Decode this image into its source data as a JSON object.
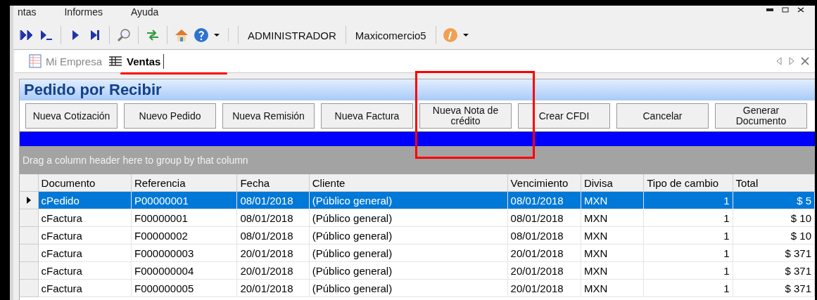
{
  "menu": [
    "ntas",
    "Informes",
    "Ayuda"
  ],
  "toolbar": {
    "user": "ADMINISTRADOR",
    "company": "Maxicomercio5"
  },
  "tabs": [
    {
      "label": "Mi Empresa",
      "selected": false
    },
    {
      "label": "Ventas",
      "selected": true
    }
  ],
  "panel_title": "Pedido por Recibir",
  "buttons": [
    "Nueva Cotización",
    "Nuevo Pedido",
    "Nueva Remisión",
    "Nueva Factura",
    "Nueva Nota de crédito",
    "Crear CFDI",
    "Cancelar",
    "Generar Documento"
  ],
  "group_hint": "Drag a column header here to group by that column",
  "table": {
    "columns": [
      {
        "label": "Documento",
        "kind": "text"
      },
      {
        "label": "Referencia",
        "kind": "text"
      },
      {
        "label": "Fecha",
        "kind": "text"
      },
      {
        "label": "Cliente",
        "kind": "text"
      },
      {
        "label": "Vencimiento",
        "kind": "text"
      },
      {
        "label": "Divisa",
        "kind": "text"
      },
      {
        "label": "Tipo de cambio",
        "kind": "number"
      },
      {
        "label": "Total",
        "kind": "number"
      }
    ],
    "rows": [
      {
        "selected": true,
        "cells": [
          "cPedido",
          "P00000001",
          "08/01/2018",
          "(Público general)",
          "08/01/2018",
          "MXN",
          "1",
          "$ 5"
        ]
      },
      {
        "selected": false,
        "cells": [
          "cFactura",
          "F00000001",
          "08/01/2018",
          "(Público general)",
          "08/01/2018",
          "MXN",
          "1",
          "$ 10"
        ]
      },
      {
        "selected": false,
        "cells": [
          "cFactura",
          "F00000002",
          "08/01/2018",
          "(Público general)",
          "08/01/2018",
          "MXN",
          "1",
          "$ 10"
        ]
      },
      {
        "selected": false,
        "cells": [
          "cFactura",
          "F000000003",
          "20/01/2018",
          "(Público general)",
          "20/01/2018",
          "MXN",
          "1",
          "$ 371"
        ]
      },
      {
        "selected": false,
        "cells": [
          "cFactura",
          "F000000004",
          "20/01/2018",
          "(Público general)",
          "20/01/2018",
          "MXN",
          "1",
          "$ 371"
        ]
      },
      {
        "selected": false,
        "cells": [
          "cFactura",
          "F000000005",
          "20/01/2018",
          "(Público general)",
          "20/01/2018",
          "MXN",
          "1",
          "$ 371"
        ]
      }
    ]
  }
}
